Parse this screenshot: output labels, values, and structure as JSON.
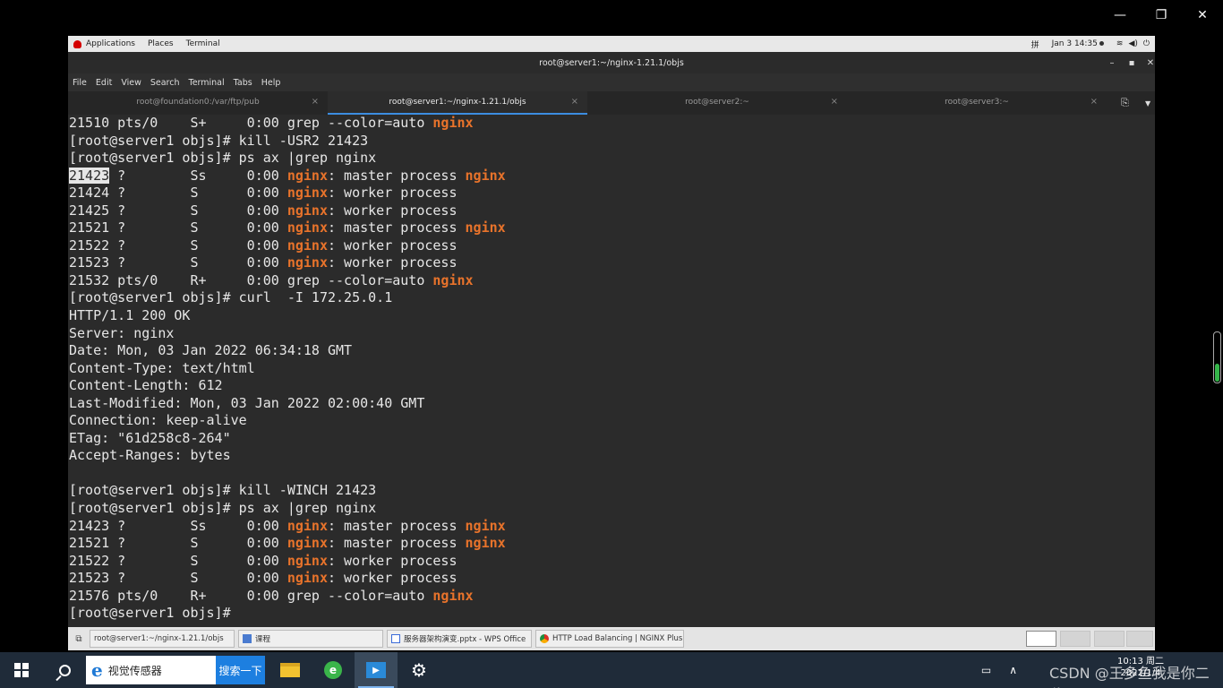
{
  "player": {
    "minimize": "—",
    "restore": "❐",
    "close": "✕"
  },
  "topbar": {
    "applications": "Applications",
    "places": "Places",
    "terminal": "Terminal",
    "input_method": "拼",
    "datetime": "Jan 3  14:35"
  },
  "window": {
    "title": "root@server1:~/nginx-1.21.1/objs",
    "minimize": "–",
    "maximize": "▪",
    "close": "✕"
  },
  "menu": [
    "File",
    "Edit",
    "View",
    "Search",
    "Terminal",
    "Tabs",
    "Help"
  ],
  "tabs": [
    {
      "label": "root@foundation0:/var/ftp/pub"
    },
    {
      "label": "root@server1:~/nginx-1.21.1/objs"
    },
    {
      "label": "root@server2:~"
    },
    {
      "label": "root@server3:~"
    }
  ],
  "terminal_lines": [
    [
      {
        "t": "21510 pts/0    S+     0:00 grep --color=auto "
      },
      {
        "t": "nginx",
        "c": "hl"
      }
    ],
    [
      {
        "t": "[root@server1 objs]# kill -USR2 21423"
      }
    ],
    [
      {
        "t": "[root@server1 objs]# ps ax |grep nginx"
      }
    ],
    [
      {
        "t": "21423",
        "c": "sel"
      },
      {
        "t": " ?        Ss     0:00 "
      },
      {
        "t": "nginx",
        "c": "hl"
      },
      {
        "t": ": master process "
      },
      {
        "t": "nginx",
        "c": "hl"
      }
    ],
    [
      {
        "t": "21424 ?        S      0:00 "
      },
      {
        "t": "nginx",
        "c": "hl"
      },
      {
        "t": ": worker process"
      }
    ],
    [
      {
        "t": "21425 ?        S      0:00 "
      },
      {
        "t": "nginx",
        "c": "hl"
      },
      {
        "t": ": worker process"
      }
    ],
    [
      {
        "t": "21521 ?        S      0:00 "
      },
      {
        "t": "nginx",
        "c": "hl"
      },
      {
        "t": ": master process "
      },
      {
        "t": "nginx",
        "c": "hl"
      }
    ],
    [
      {
        "t": "21522 ?        S      0:00 "
      },
      {
        "t": "nginx",
        "c": "hl"
      },
      {
        "t": ": worker process"
      }
    ],
    [
      {
        "t": "21523 ?        S      0:00 "
      },
      {
        "t": "nginx",
        "c": "hl"
      },
      {
        "t": ": worker process"
      }
    ],
    [
      {
        "t": "21532 pts/0    R+     0:00 grep --color=auto "
      },
      {
        "t": "nginx",
        "c": "hl"
      }
    ],
    [
      {
        "t": "[root@server1 objs]# curl  -I 172.25.0.1"
      }
    ],
    [
      {
        "t": "HTTP/1.1 200 OK"
      }
    ],
    [
      {
        "t": "Server: nginx"
      }
    ],
    [
      {
        "t": "Date: Mon, 03 Jan 2022 06:34:18 GMT"
      }
    ],
    [
      {
        "t": "Content-Type: text/html"
      }
    ],
    [
      {
        "t": "Content-Length: 612"
      }
    ],
    [
      {
        "t": "Last-Modified: Mon, 03 Jan 2022 02:00:40 GMT"
      }
    ],
    [
      {
        "t": "Connection: keep-alive"
      }
    ],
    [
      {
        "t": "ETag: \"61d258c8-264\""
      }
    ],
    [
      {
        "t": "Accept-Ranges: bytes"
      }
    ],
    [
      {
        "t": ""
      }
    ],
    [
      {
        "t": "[root@server1 objs]# kill -WINCH 21423"
      }
    ],
    [
      {
        "t": "[root@server1 objs]# ps ax |grep nginx"
      }
    ],
    [
      {
        "t": "21423 ?        Ss     0:00 "
      },
      {
        "t": "nginx",
        "c": "hl"
      },
      {
        "t": ": master process "
      },
      {
        "t": "nginx",
        "c": "hl"
      }
    ],
    [
      {
        "t": "21521 ?        S      0:00 "
      },
      {
        "t": "nginx",
        "c": "hl"
      },
      {
        "t": ": master process "
      },
      {
        "t": "nginx",
        "c": "hl"
      }
    ],
    [
      {
        "t": "21522 ?        S      0:00 "
      },
      {
        "t": "nginx",
        "c": "hl"
      },
      {
        "t": ": worker process"
      }
    ],
    [
      {
        "t": "21523 ?        S      0:00 "
      },
      {
        "t": "nginx",
        "c": "hl"
      },
      {
        "t": ": worker process"
      }
    ],
    [
      {
        "t": "21576 pts/0    R+     0:00 grep --color=auto "
      },
      {
        "t": "nginx",
        "c": "hl"
      }
    ],
    [
      {
        "t": "[root@server1 objs]# "
      }
    ]
  ],
  "window_list": [
    {
      "label": "root@server1:~/nginx-1.21.1/objs"
    },
    {
      "label": "课程"
    },
    {
      "label": "服务器架构演变.pptx - WPS Office"
    },
    {
      "label": "HTTP Load Balancing | NGINX Plus ..."
    }
  ],
  "taskbar": {
    "search_text": "视觉传感器",
    "search_button": "搜索一下",
    "tray_text": "∧",
    "watermark": "CSDN @王多鱼我是你二爷",
    "clock_time": "10:13 周二",
    "clock_date": "2022/1/4"
  },
  "colors": {
    "terminal_bg": "#2b2b2b",
    "terminal_fg": "#e6e6e6",
    "match_highlight": "#e8732b",
    "active_tab_underline": "#3c8de0",
    "taskbar_bg": "#1f2b39"
  },
  "icons": {
    "start": "windows-logo-icon",
    "search": "search-icon",
    "browser": "ie-icon",
    "explorer": "folder-icon",
    "qihoo": "360-browser-icon",
    "player": "video-player-icon",
    "settings": "gear-icon",
    "new_tab": "new-tab-icon",
    "tab_menu": "chevron-down-icon"
  }
}
